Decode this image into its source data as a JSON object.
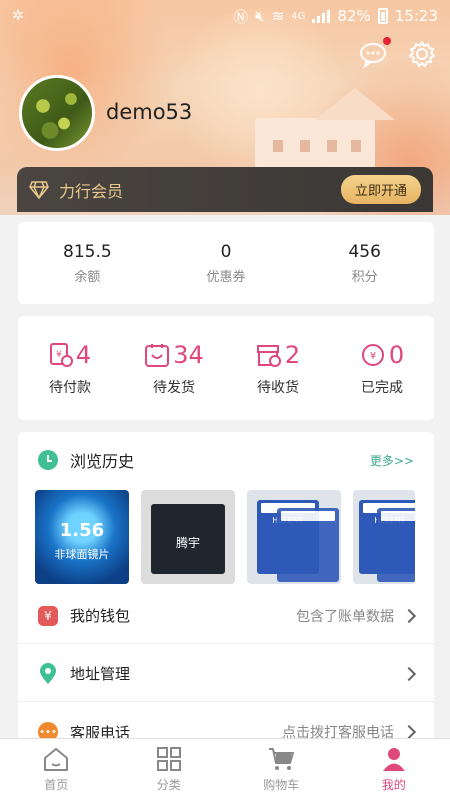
{
  "status": {
    "time": "15:23",
    "battery": "82%",
    "network": "4G"
  },
  "profile": {
    "username": "demo53"
  },
  "member": {
    "label": "力行会员",
    "button": "立即开通"
  },
  "stats": [
    {
      "value": "815.5",
      "label": "余额"
    },
    {
      "value": "0",
      "label": "优惠券"
    },
    {
      "value": "456",
      "label": "积分"
    }
  ],
  "orders": [
    {
      "count": "4",
      "label": "待付款",
      "icon": "payment-icon"
    },
    {
      "count": "34",
      "label": "待发货",
      "icon": "shipping-icon"
    },
    {
      "count": "2",
      "label": "待收货",
      "icon": "receive-icon"
    },
    {
      "count": "0",
      "label": "已完成",
      "icon": "completed-icon"
    }
  ],
  "history": {
    "title": "浏览历史",
    "more": "更多>>",
    "items": [
      {
        "line1": "1.56",
        "line2": "非球面镜片"
      },
      {
        "line1": "腾宇"
      },
      {
        "line1": "HELENE"
      },
      {
        "line1": "HELENE"
      }
    ]
  },
  "menu": [
    {
      "label": "我的钱包",
      "sub": "包含了账单数据",
      "icon": "wallet-icon",
      "color": "#e35a5a"
    },
    {
      "label": "地址管理",
      "sub": "",
      "icon": "location-icon",
      "color": "#3fbf94"
    },
    {
      "label": "客服电话",
      "sub": "点击拨打客服电话",
      "icon": "service-icon",
      "color": "#f08a2c"
    }
  ],
  "tabs": [
    {
      "label": "首页",
      "icon": "home-icon"
    },
    {
      "label": "分类",
      "icon": "category-icon"
    },
    {
      "label": "购物车",
      "icon": "cart-icon"
    },
    {
      "label": "我的",
      "icon": "profile-icon",
      "active": true
    }
  ],
  "colors": {
    "accent": "#e0487a",
    "gold": "#e8c98a",
    "more": "#3daa8c"
  }
}
